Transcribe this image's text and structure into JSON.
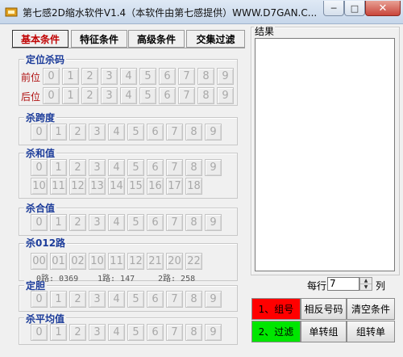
{
  "window": {
    "title": "第七感2D缩水软件V1.4（本软件由第七感提供）WWW.D7GAN.C...",
    "min_label": "─",
    "max_label": "□",
    "close_label": "✕"
  },
  "tabs": [
    {
      "label": "基本条件",
      "active": true
    },
    {
      "label": "特征条件",
      "active": false
    },
    {
      "label": "高级条件",
      "active": false
    },
    {
      "label": "交集过滤",
      "active": false
    }
  ],
  "groups": {
    "position_kill": {
      "title": "定位杀码",
      "rows": [
        {
          "label": "前位"
        },
        {
          "label": "后位"
        }
      ]
    },
    "span_kill": {
      "title": "杀跨度"
    },
    "sum_kill": {
      "title": "杀和值"
    },
    "combined_kill": {
      "title": "杀合值"
    },
    "road_kill": {
      "title": "杀012路",
      "stats": [
        "0路: 0369",
        "1路: 147",
        "2路: 258"
      ]
    },
    "fixed_gall": {
      "title": "定胆"
    },
    "avg_kill": {
      "title": "杀平均值"
    }
  },
  "digits": [
    "0",
    "1",
    "2",
    "3",
    "4",
    "5",
    "6",
    "7",
    "8",
    "9"
  ],
  "sum_digits_row1": [
    "0",
    "1",
    "2",
    "3",
    "4",
    "5",
    "6",
    "7",
    "8",
    "9"
  ],
  "sum_digits_row2": [
    "10",
    "11",
    "12",
    "13",
    "14",
    "15",
    "16",
    "17",
    "18"
  ],
  "span_digits": [
    "0",
    "1",
    "2",
    "3",
    "4",
    "5",
    "6",
    "7",
    "8",
    "9"
  ],
  "road_combos": [
    "00",
    "01",
    "02",
    "10",
    "11",
    "12",
    "21",
    "20",
    "22"
  ],
  "results": {
    "label": "结果",
    "per_row_label": "每行",
    "per_row_value": "7",
    "col_label": "列"
  },
  "actions": {
    "group_number": "1、组号",
    "reverse_number": "相反号码",
    "clear_conditions": "清空条件",
    "filter": "2、过滤",
    "single_to_group": "单转组",
    "group_to_single": "组转单"
  },
  "colors": {
    "accent_red": "#ff0000",
    "accent_green": "#00e600",
    "title_blue": "#1c3c9a",
    "label_red": "#b01010"
  }
}
